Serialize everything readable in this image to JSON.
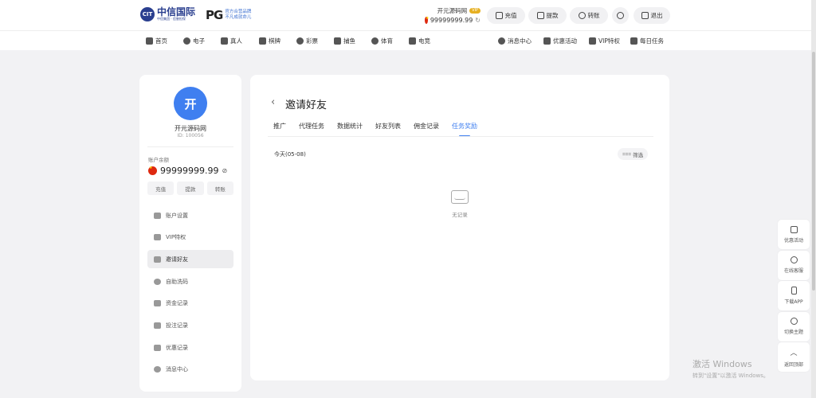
{
  "header": {
    "logo_text": "中信国际",
    "logo_sub": "中信集团 · 信誉担保",
    "pg_mark": "PG",
    "pg_line1": "官方合营品牌",
    "pg_line2": "不凡成就命儿",
    "username": "开元源码网",
    "vip_tag": "VIP",
    "balance": "99999999.99",
    "buttons": {
      "deposit": "充值",
      "withdraw": "提款",
      "transfer": "转账",
      "logout": "退出"
    }
  },
  "nav": {
    "left": [
      "首页",
      "电子",
      "真人",
      "棋牌",
      "彩票",
      "捕鱼",
      "体育",
      "电竞"
    ],
    "right": [
      "消息中心",
      "优惠活动",
      "VIP特权",
      "每日任务"
    ]
  },
  "sidebar": {
    "avatar_letter": "开",
    "name": "开元源码网",
    "id": "ID: 100056",
    "balance_label": "账户余额",
    "balance": "99999999.99",
    "actions": [
      "充值",
      "提款",
      "转账"
    ],
    "menu": [
      {
        "label": "账户设置",
        "icon": "id-card-icon"
      },
      {
        "label": "VIP特权",
        "icon": "diamond-icon"
      },
      {
        "label": "邀请好友",
        "icon": "invite-icon"
      },
      {
        "label": "自助洗码",
        "icon": "chip-icon"
      },
      {
        "label": "资金记录",
        "icon": "card-icon"
      },
      {
        "label": "投注记录",
        "icon": "clipboard-icon"
      },
      {
        "label": "优惠记录",
        "icon": "gift-icon"
      },
      {
        "label": "消息中心",
        "icon": "chat-icon"
      }
    ],
    "active_index": 2
  },
  "main": {
    "back_symbol": "‹",
    "title": "邀请好友",
    "tabs": [
      "推广",
      "代理任务",
      "数据统计",
      "好友列表",
      "佣金记录",
      "任务奖励"
    ],
    "active_tab": 5,
    "date_label": "今天(05-08)",
    "filter_label": "筛选",
    "empty_text": "无记录"
  },
  "float_panel": [
    "优惠活动",
    "在线客服",
    "下载APP",
    "切换主题",
    "返回顶部"
  ],
  "watermark": {
    "line1": "激活 Windows",
    "line2": "转到\"设置\"以激活 Windows。"
  },
  "colors": {
    "accent": "#3f7ff0",
    "vip": "#e6b022",
    "page_bg": "#f2f2f4"
  }
}
